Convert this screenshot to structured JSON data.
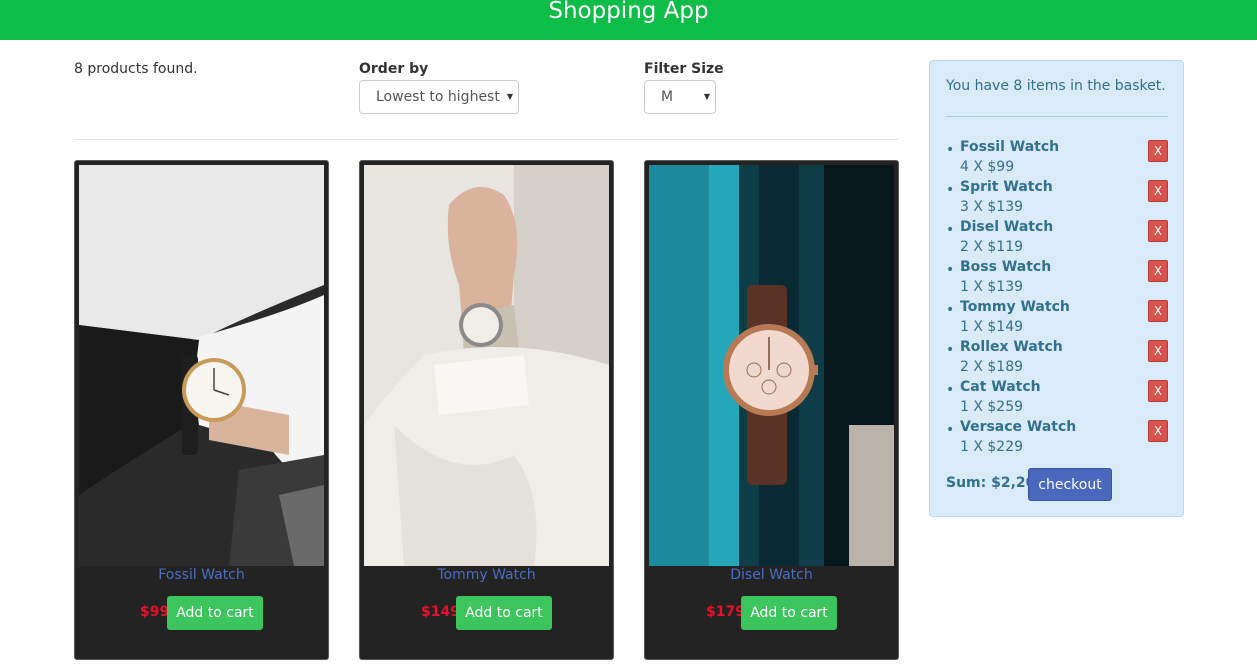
{
  "app": {
    "title": "Shopping App"
  },
  "filters": {
    "count_text": "8 products found.",
    "order_label": "Order by",
    "order_value": "Lowest to highest",
    "size_label": "Filter Size",
    "size_value": "M"
  },
  "products": [
    {
      "title": "Fossil Watch",
      "price": "$99",
      "button": "Add to cart"
    },
    {
      "title": "Tommy Watch",
      "price": "$149",
      "button": "Add to cart"
    },
    {
      "title": "Disel Watch",
      "price": "$179",
      "button": "Add to cart"
    }
  ],
  "basket": {
    "message": "You have 8 items in the basket.",
    "items": [
      {
        "name": "Fossil Watch",
        "qty": "4 X $99",
        "remove": "X"
      },
      {
        "name": "Sprit Watch",
        "qty": "3 X $139",
        "remove": "X"
      },
      {
        "name": "Disel Watch",
        "qty": "2 X $119",
        "remove": "X"
      },
      {
        "name": "Boss Watch",
        "qty": "1 X $139",
        "remove": "X"
      },
      {
        "name": "Tommy Watch",
        "qty": "1 X $149",
        "remove": "X"
      },
      {
        "name": "Rollex Watch",
        "qty": "2 X $189",
        "remove": "X"
      },
      {
        "name": "Cat Watch",
        "qty": "1 X $259",
        "remove": "X"
      },
      {
        "name": "Versace Watch",
        "qty": "1 X $229",
        "remove": "X"
      }
    ],
    "sum": "Sum: $2,205",
    "checkout": "checkout"
  },
  "colors": {
    "header": "#0dbd47",
    "price": "#e8102a",
    "add_button": "#3dc55d",
    "checkout": "#4a68bd",
    "remove": "#d9534f"
  }
}
